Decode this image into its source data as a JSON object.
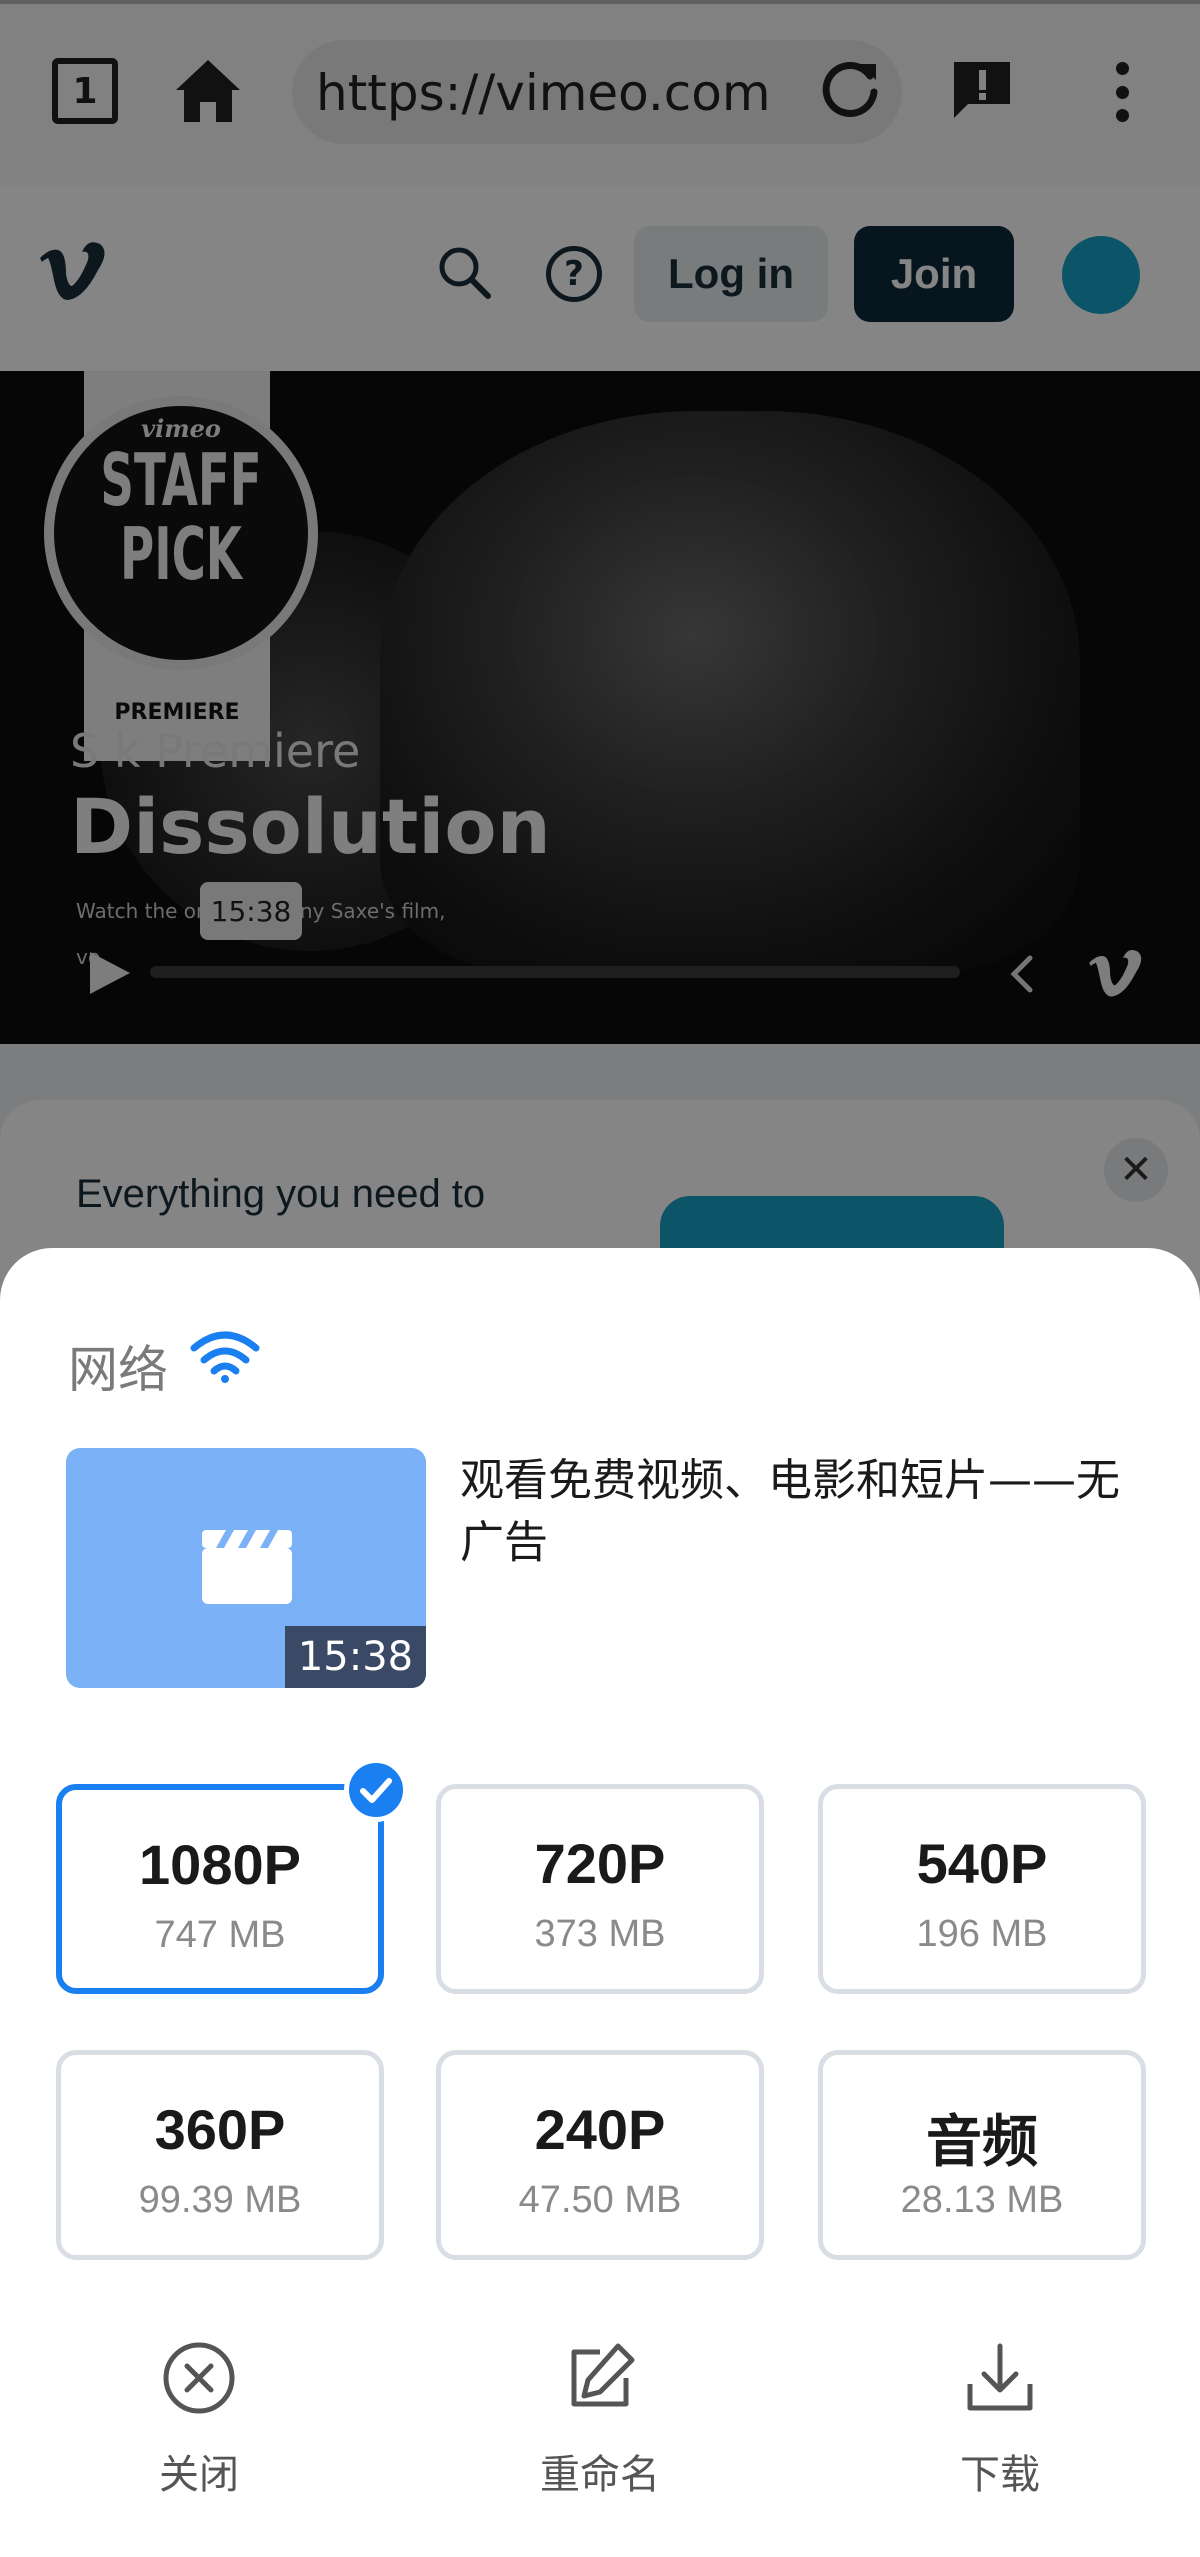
{
  "browser": {
    "tab_count": "1",
    "url": "https://vimeo.com"
  },
  "site_header": {
    "login_label": "Log in",
    "join_label": "Join"
  },
  "video": {
    "badge_brand": "vimeo",
    "badge_line1": "STAFF",
    "badge_line2": "PICK",
    "badge_footer": "PREMIERE",
    "subtitle": "S      k Premiere",
    "title": "Dissolution",
    "description_line1": "Watch the on           of Anthony Saxe's film,",
    "description_line2": "           ve",
    "hover_time": "15:38",
    "progress": 0.0
  },
  "promo": {
    "text": "Everything you need to"
  },
  "sheet": {
    "network_label": "网络",
    "video_title": "观看免费视频、电影和短片——无广告",
    "duration": "15:38",
    "qualities": [
      {
        "label": "1080P",
        "size": "747 MB",
        "selected": true
      },
      {
        "label": "720P",
        "size": "373 MB",
        "selected": false
      },
      {
        "label": "540P",
        "size": "196 MB",
        "selected": false
      },
      {
        "label": "360P",
        "size": "99.39 MB",
        "selected": false
      },
      {
        "label": "240P",
        "size": "47.50 MB",
        "selected": false
      },
      {
        "label": "音频",
        "size": "28.13 MB",
        "selected": false
      }
    ],
    "actions": {
      "close": "关闭",
      "rename": "重命名",
      "download": "下载"
    }
  },
  "colors": {
    "accent": "#1a7ff0",
    "thumbnail": "#7bb1f7",
    "vimeo_brand": "#17a2c8",
    "join_button": "#0d2a3a"
  }
}
